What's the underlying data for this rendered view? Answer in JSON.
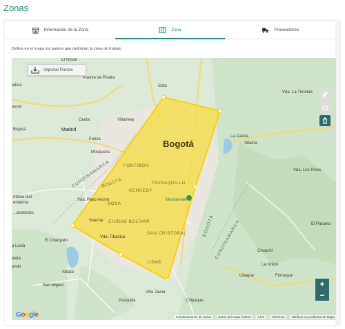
{
  "page": {
    "title": "Zonas"
  },
  "tabs": [
    {
      "label": "Información de la Zona",
      "icon": "store-icon",
      "active": false
    },
    {
      "label": "Zona",
      "icon": "map-icon",
      "active": true
    },
    {
      "label": "Proveedores",
      "icon": "truck-icon",
      "active": false
    }
  ],
  "instructions": "Defina en el mapa los puntos que delimitan la zona de trabajo.",
  "map": {
    "import_button": "Importar Puntos",
    "zoom_in": "+",
    "zoom_out": "−",
    "google_logo": "Google",
    "attribution": {
      "shortcuts": "Combinaciones de teclas",
      "data": "Datos del mapa ©2023",
      "scale": "5 km",
      "terms": "Términos",
      "report": "Notificar un problema de Maps"
    },
    "labels": {
      "bogota": "Bogotá",
      "el_rosal": "El Rosal",
      "puente_de_piedra": "Puente de Piedra",
      "tativa": "tativá",
      "cota": "Cota",
      "vda_la_trinidad": "Vda. La Trinidad",
      "suscal": "uscal",
      "madrid": "Madrid",
      "ceuta": "Ceuta",
      "villamery": "Villamery",
      "la_calera": "La Calera",
      "siberia": "Siberia",
      "bojaca": "Bojacá",
      "funza": "Funza",
      "mosquera": "Mosquera",
      "fontibon": "FONTIBÓN",
      "kennedy": "KENNEDY",
      "teusaquillo": "TEUSAQUILLO",
      "bogota_district": "BOGOTÁ",
      "bosa": "BOSA",
      "vda_paso_ancho": "Vda. Paso Ancho",
      "soacha": "Soacha",
      "ciudad_bolivar": "CIUDAD BOLÍVAR",
      "san_cristobal": "SAN CRISTÓBAL",
      "monserrate": "Monserrate",
      "vda_tibanica": "Vda. Tibanica",
      "usme": "USME",
      "el_charquito": "El Charquito",
      "la_union": "La Unión",
      "choachi": "Choachí",
      "ubaque": "Ubaque",
      "fomeque": "Fómeque",
      "san_miguel": "San Miguel",
      "pasquilla": "Pasquilla",
      "chipaque": "Chipaque",
      "villa_javier": "Villa Javier",
      "sibate": "Sibaté",
      "cundinamarca_w": "CUNDINAMARCA",
      "cundinamarca_e": "CUNDINAMARCA",
      "bogota_road": "BOGOTÁ",
      "vda_los_pinos": "Vda. Los Pinos",
      "el_paramo": "El Paramo",
      "antonio_del": "ntonio Del",
      "tequendama": "endama",
      "vda_leon": "Vda. Le...",
      "sucre": "...ucre",
      "anandercito": "...andercito",
      "la_lucia": "a Lucia",
      "ulata": "ulata",
      "undo": "undo",
      "silvania": "Silv...",
      "anquetala": "...",
      "la_torre": "o"
    }
  },
  "colors": {
    "accent": "#1f8a7a",
    "zone_fill": "#f5dc3a",
    "zone_stroke": "#f3d20b",
    "tool_dark": "#2f6a6a"
  }
}
